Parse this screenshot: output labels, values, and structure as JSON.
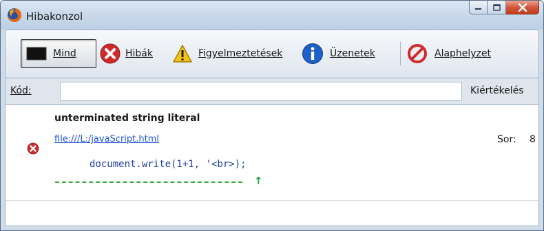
{
  "window": {
    "title": "Hibakonzol",
    "controls": [
      "minimize",
      "maximize",
      "close"
    ]
  },
  "toolbar": {
    "all": {
      "label": "Mind",
      "icon": "monitor-icon",
      "active": true
    },
    "errors": {
      "label": "Hibák",
      "icon": "error-icon"
    },
    "warnings": {
      "label": "Figyelmeztetések",
      "icon": "warning-icon"
    },
    "messages": {
      "label": "Üzenetek",
      "icon": "info-icon"
    },
    "clear": {
      "label": "Alaphelyzet",
      "icon": "no-entry-icon"
    }
  },
  "code_bar": {
    "label": "Kód:",
    "value": "",
    "evaluate_label": "Kiértékelés"
  },
  "entries": [
    {
      "type": "error",
      "message": "unterminated string literal",
      "source": "file:///L:/javaScript.html",
      "line_label": "Sor:",
      "line": "8",
      "code": "document.write(1+1, '<br>);",
      "pointer": "↑"
    }
  ],
  "colors": {
    "error": "#d12a2a",
    "warning": "#f2c515",
    "info": "#1f5fc8",
    "link": "#1d52d4",
    "code": "#1e3ea1",
    "pointer": "#22a33a"
  }
}
